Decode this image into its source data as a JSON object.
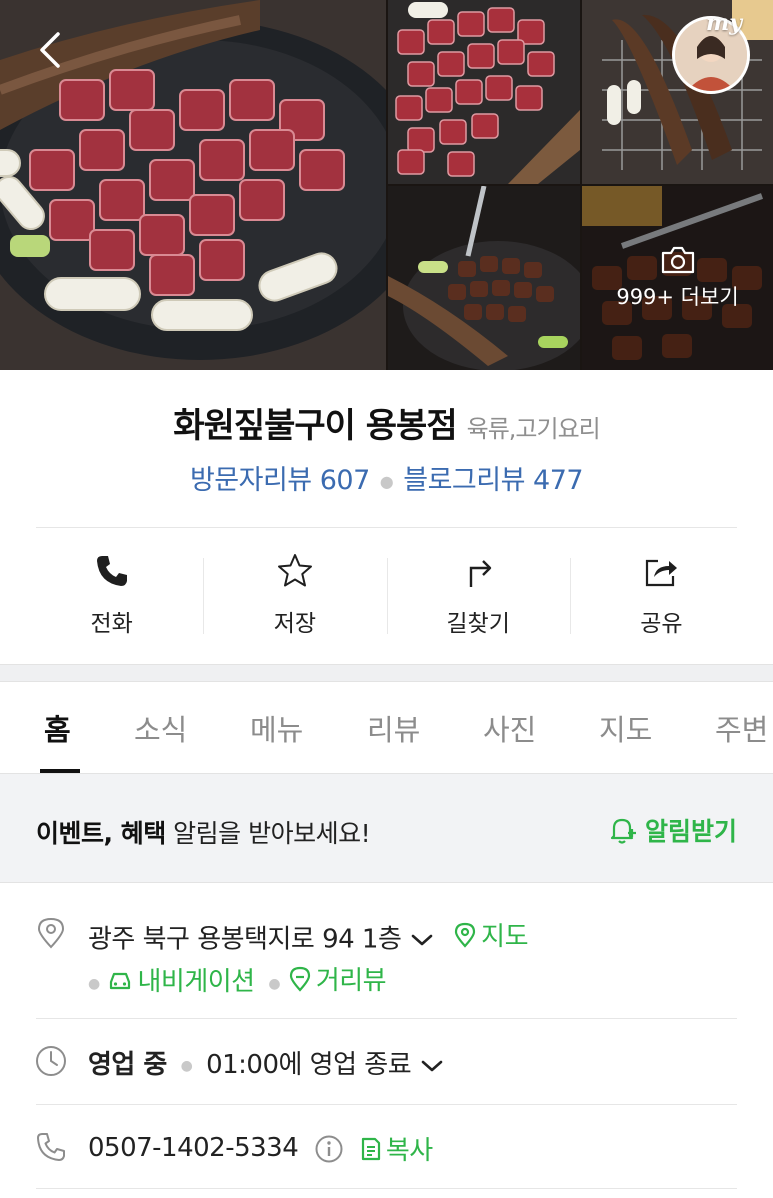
{
  "gallery": {
    "my_badge": "my",
    "more_label": "999+ 더보기"
  },
  "place": {
    "name": "화원짚불구이 용봉점",
    "category": "육류,고기요리"
  },
  "reviews": {
    "visitor": "방문자리뷰 607",
    "blog": "블로그리뷰 477"
  },
  "actions": [
    {
      "label": "전화",
      "icon": "phone-icon"
    },
    {
      "label": "저장",
      "icon": "star-icon"
    },
    {
      "label": "길찾기",
      "icon": "directions-icon"
    },
    {
      "label": "공유",
      "icon": "share-icon"
    }
  ],
  "tabs": [
    {
      "label": "홈",
      "active": true
    },
    {
      "label": "소식"
    },
    {
      "label": "메뉴"
    },
    {
      "label": "리뷰"
    },
    {
      "label": "사진"
    },
    {
      "label": "지도"
    },
    {
      "label": "주변"
    }
  ],
  "notice": {
    "bold": "이벤트, 혜택",
    "rest": " 알림을 받아보세요!",
    "button": "알림받기"
  },
  "address": {
    "text": "광주 북구 용봉택지로 94 1층",
    "map": "지도",
    "navigation": "내비게이션",
    "streetview": "거리뷰"
  },
  "hours": {
    "status": "영업 중",
    "detail": "01:00에 영업 종료"
  },
  "phone": {
    "number": "0507-1402-5334",
    "copy": "복사"
  },
  "colors": {
    "accent_green": "#2fb549",
    "review_blue": "#3b6bb0"
  }
}
